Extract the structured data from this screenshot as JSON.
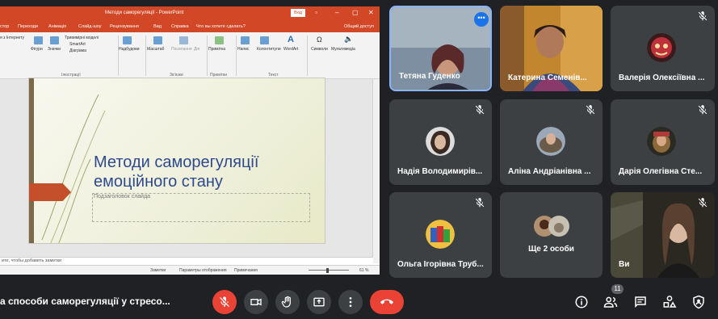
{
  "presentation": {
    "window_title": "Методи саморегуляції - PowerPoint",
    "sign_in": "Вхід",
    "menu": [
      "стор",
      "Переходи",
      "Анімація",
      "Слайд-шоу",
      "Рецензування",
      "Вид",
      "Справка",
      "Что вы хотите сделать?",
      "Общий доступ"
    ],
    "ribbon": {
      "items": [
        "я з Інтернету",
        "Фігури",
        "Значки",
        "Тривимірні моделі",
        "SmartArt",
        "Діаграма",
        "Надбудови",
        "Масштаб",
        "Посилання",
        "Дія",
        "Примітка",
        "Напис",
        "Колонтитули",
        "WordArt",
        "Символи",
        "Мультимедіа"
      ],
      "groups": [
        "Ілюстрації",
        "Зв'язки",
        "Примітки",
        "Текст"
      ]
    },
    "slide": {
      "title_line1": "Методи саморегуляції",
      "title_line2": "емоційного стану",
      "subtitle": "Подзаголовок слайда"
    },
    "notes_placeholder": "ите, чтобы добавить заметки",
    "status": {
      "notes": "Заметки",
      "display": "Параметры отображения",
      "comments": "Примечания",
      "zoom": "61 %"
    }
  },
  "participants": [
    {
      "name": "Тетяна Гуденко",
      "active": true,
      "muted": false,
      "video": true
    },
    {
      "name": "Катерина Семенів...",
      "muted": false,
      "video": true
    },
    {
      "name": "Валерія Олексіївна ...",
      "muted": true,
      "video": false
    },
    {
      "name": "Надія Володимирів...",
      "muted": true,
      "video": false
    },
    {
      "name": "Аліна Андріанівна ...",
      "muted": true,
      "video": false
    },
    {
      "name": "Дарія Олегівна Сте...",
      "muted": true,
      "video": false
    },
    {
      "name": "Ольга Ігорівна Труб...",
      "muted": true,
      "video": false
    },
    {
      "name": "Ще 2 особи",
      "muted": false,
      "video": false
    },
    {
      "name": "Ви",
      "muted": true,
      "video": true
    }
  ],
  "meeting": {
    "title": "а способи саморегуляції у стресо...",
    "participant_count": "11",
    "more_options": "•••"
  },
  "colors": {
    "accent": "#8ab4f8",
    "red": "#ea4335",
    "tile": "#3c4043",
    "bg": "#202124",
    "ppt": "#d24726"
  },
  "icons": [
    "mic-off-icon",
    "camera-icon",
    "raise-hand-icon",
    "present-icon",
    "more-vert-icon",
    "end-call-icon",
    "info-icon",
    "people-icon",
    "chat-icon",
    "activities-icon",
    "host-controls-icon"
  ]
}
